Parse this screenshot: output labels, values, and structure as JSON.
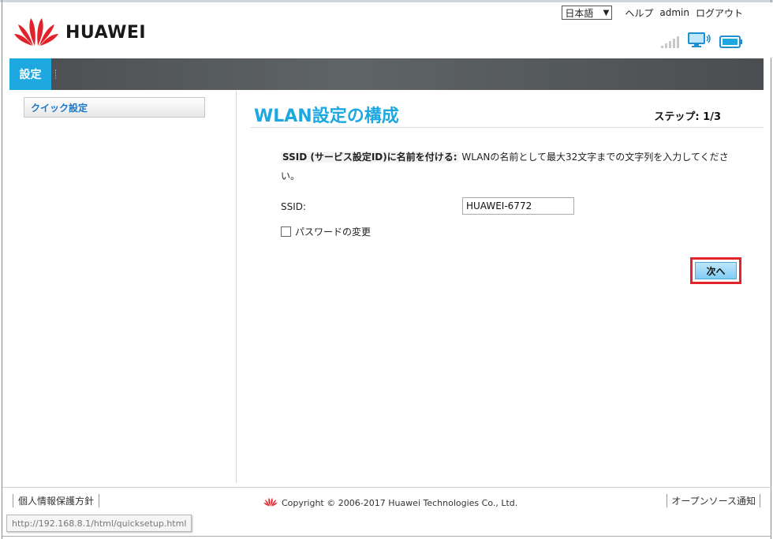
{
  "header": {
    "brand": "HUAWEI",
    "language": "日本語",
    "links": [
      "ヘルプ",
      "admin",
      "ログアウト"
    ]
  },
  "icons": {
    "logo": "huawei-flower-logo",
    "signal": "signal-strength-icon",
    "computer": "computer-connection-icon",
    "battery": "battery-icon"
  },
  "nav": {
    "active_tab": "設定"
  },
  "sidebar": {
    "items": [
      {
        "label": "クイック設定"
      }
    ]
  },
  "main": {
    "title": "WLAN設定の構成",
    "step": "ステップ: 1/3",
    "desc_bold": "SSID (サービス設定ID)に名前を付ける:",
    "desc_text": " WLANの名前として最大32文字までの文字列を入力してください。",
    "ssid_label": "SSID:",
    "ssid_value": "HUAWEI-6772",
    "password_change_label": "パスワードの変更",
    "password_change_checked": false,
    "next_button": "次へ"
  },
  "footer": {
    "privacy": "個人情報保護方針",
    "copyright": "Copyright © 2006-2017 Huawei Technologies Co., Ltd.",
    "opensource": "オープンソース通知"
  },
  "status_url": "http://192.168.8.1/html/quicksetup.html",
  "colors": {
    "accent": "#1ea8e0",
    "navbar": "#54585b",
    "highlight": "#e3242b",
    "brand_red": "#e1222a"
  }
}
